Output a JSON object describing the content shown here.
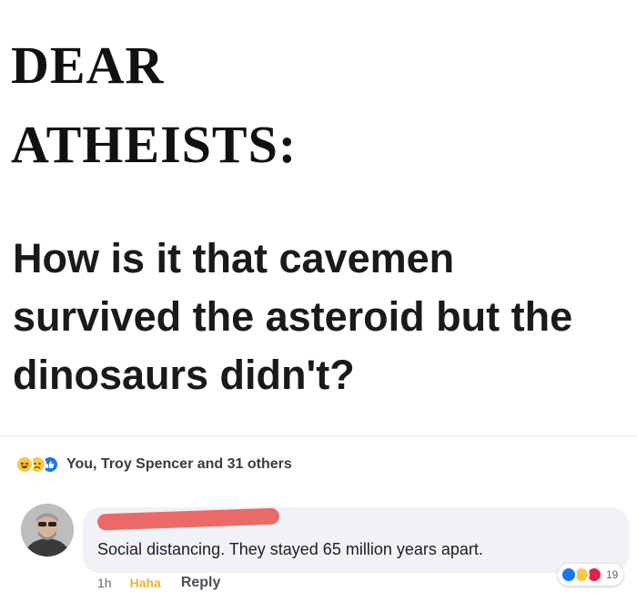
{
  "post": {
    "headline_line1": "DEAR",
    "headline_line2": "ATHEISTS:",
    "question": "How is it that cavemen survived the asteroid but the dinosaurs didn't?"
  },
  "reactions": {
    "icons": [
      "haha-icon",
      "sad-icon",
      "like-icon"
    ],
    "summary": "You, Troy Spencer and 31 others"
  },
  "comment": {
    "text": "Social distancing. They stayed 65 million years apart.",
    "time": "1h",
    "haha_label": "Haha",
    "reply_label": "Reply",
    "reaction_icons": [
      "like-icon",
      "haha-icon",
      "love-icon"
    ],
    "reaction_count": "19"
  },
  "colors": {
    "facebook_blue": "#1877f2",
    "haha_yellow": "#f7c948",
    "haha_label": "#f0b429",
    "love_red": "#e0244d",
    "redaction": "#ea6a68",
    "bubble_bg": "#f0f2f5"
  }
}
